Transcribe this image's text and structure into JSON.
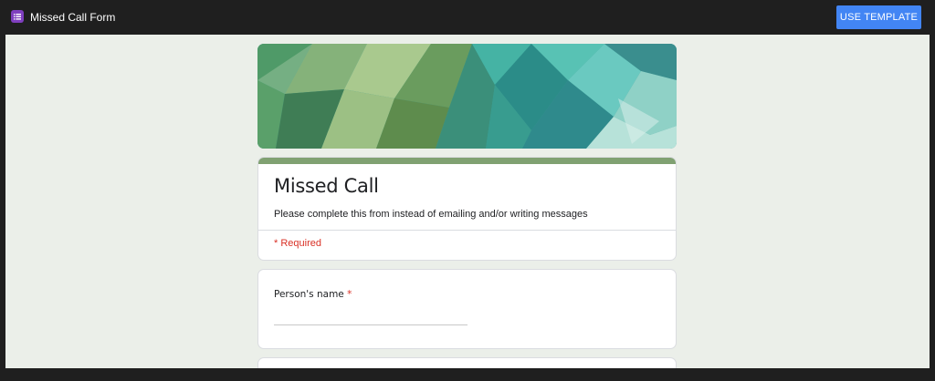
{
  "app": {
    "title": "Missed Call Form",
    "icon": "forms-list-icon",
    "use_template_label": "USE TEMPLATE"
  },
  "form": {
    "title": "Missed Call",
    "description": "Please complete this from instead of emailing and/or writing messages",
    "required_note": "* Required",
    "questions": [
      {
        "label": "Person's name",
        "required_mark": "*",
        "value": ""
      }
    ]
  },
  "colors": {
    "accent": "#80a172",
    "button": "#4285f4",
    "required": "#d93025",
    "canvas": "#ebefe9",
    "topbar": "#1f1f1f"
  }
}
